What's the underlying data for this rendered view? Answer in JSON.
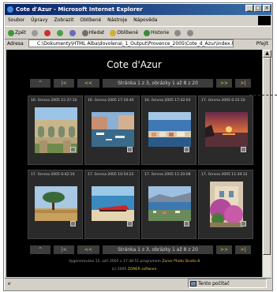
{
  "window": {
    "title": "Cote d'Azur - Microsoft Internet Explorer",
    "controls": [
      "_",
      "□",
      "×"
    ]
  },
  "menu": [
    "Soubor",
    "Úpravy",
    "Zobrazit",
    "Oblíbené",
    "Nástroje",
    "Nápověda"
  ],
  "toolbar": {
    "back": "Zpět",
    "search": "Hledat",
    "favorites": "Oblíbené",
    "history": "Historie"
  },
  "address": {
    "label": "Adresa",
    "url": "C:\\Dokumenty\\HTML Alba\\dovolena\\_1_Output\\Provence_2005\\Cote_d_Azur\\index.htm",
    "go": "Přejít"
  },
  "page": {
    "title": "Cote d'Azur",
    "nav": {
      "first": "^",
      "start": "|<",
      "prev": "<<",
      "info": "Stránka 1 z 3, obrázky 1 až 8 z 20",
      "next": ">>",
      "end": ">|"
    },
    "rows": [
      [
        {
          "date": "16. června 2005 15:37:10",
          "subject": "aqueduct-bridge"
        },
        {
          "date": "16. června 2005 17:16:40",
          "subject": "harbor-canal"
        },
        {
          "date": "16. června 2005 17:42:03",
          "subject": "coastal-town"
        },
        {
          "date": "17. června 2005 6:15:10",
          "subject": "sunset-sea"
        }
      ],
      [
        {
          "date": "17. června 2005 6:42:16",
          "subject": "pine-tree-field"
        },
        {
          "date": "17. června 2005 10:54:22",
          "subject": "red-boat-beach"
        },
        {
          "date": "17. června 2005 11:20:08",
          "subject": "bay-panorama"
        },
        {
          "date": "17. června 2005 11:39:12",
          "subject": "flowering-house"
        }
      ]
    ],
    "footer": {
      "line1_prefix": "Vygenerováno 15. září 2005 v 17:38:51 programem",
      "line1_program": "Zoner Photo Studio 8",
      "line2_prefix": "(c) 2005",
      "line2_company": "ZONER software"
    }
  },
  "status": {
    "zone": "Tento počítač"
  }
}
